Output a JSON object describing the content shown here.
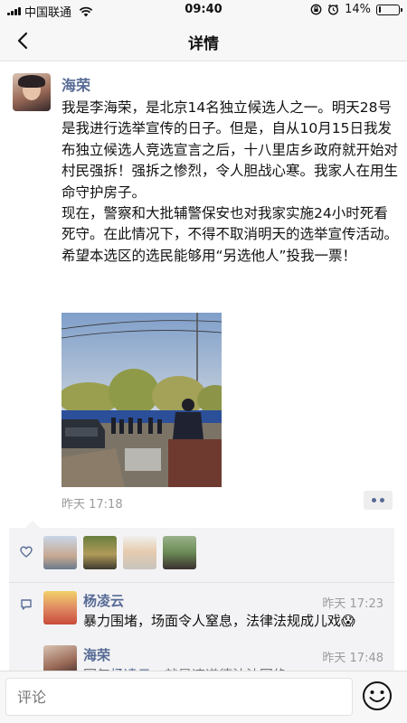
{
  "status_bar": {
    "carrier": "中国联通",
    "time": "09:40",
    "battery_text": "14%",
    "battery_level": 0.14
  },
  "nav": {
    "title": "详情",
    "back_icon": "chevron-left-icon"
  },
  "post": {
    "author": "海荣",
    "paragraphs": [
      "我是李海荣，是北京14名独立候选人之一。明天28号是我进行选举宣传的日子。但是，自从10月15日我发布独立候选人竞选宣言之后，十八里店乡政府就开始对村民强拆！强拆之惨烈，令人胆战心寒。我家人在用生命守护房子。",
      "现在，警察和大批辅警保安也对我家实施24小时死看死守。在此情况下，不得不取消明天的选举宣传活动。希望本选区的选民能够用“另选他人”投我一票！"
    ],
    "time": "昨天 17:18"
  },
  "interactions": {
    "like_icon": "heart-icon",
    "likers_count": 4,
    "comment_icon": "comment-icon",
    "comments": [
      {
        "name": "杨凌云",
        "time": "昨天 17:23",
        "text": "暴力围堵，场面令人窒息，法律法规成儿戏😱"
      },
      {
        "name": "海荣",
        "time": "昨天 17:48",
        "text_prefix": "回复",
        "reply_to": "杨凌云",
        "text": "：就是违道德法法回绝"
      }
    ]
  },
  "input": {
    "placeholder": "评论",
    "emoji_icon": "smiley-icon"
  },
  "colors": {
    "link": "#576b95",
    "timestamp": "#9b9b9b",
    "panel": "#f3f3f5"
  }
}
